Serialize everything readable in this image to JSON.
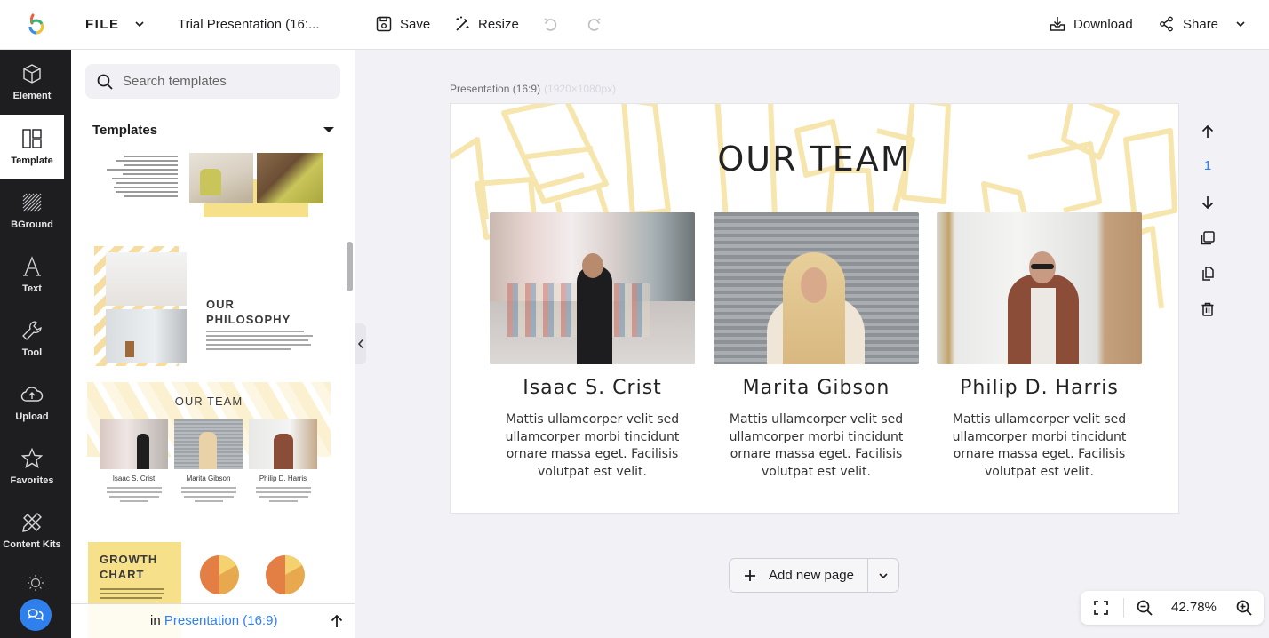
{
  "app": {
    "file_label": "FILE",
    "document_title": "Trial Presentation (16:...",
    "colors": {
      "accent": "#2f80ed",
      "rail_bg": "#1e1e20",
      "canvas_bg": "#f1f1f6",
      "theme_yellow": "#f6e08a",
      "pattern_yellow": "#fbeec2"
    }
  },
  "toolbar": {
    "save_label": "Save",
    "resize_label": "Resize",
    "undo_icon": "undo-icon",
    "redo_icon": "redo-icon",
    "download_label": "Download",
    "share_label": "Share"
  },
  "rail": {
    "items": [
      {
        "label": "Element",
        "icon": "cube-icon"
      },
      {
        "label": "Template",
        "icon": "template-icon",
        "active": true
      },
      {
        "label": "BGround",
        "icon": "background-icon"
      },
      {
        "label": "Text",
        "icon": "text-icon"
      },
      {
        "label": "Tool",
        "icon": "wrench-icon"
      },
      {
        "label": "Upload",
        "icon": "cloud-upload-icon"
      },
      {
        "label": "Favorites",
        "icon": "star-icon"
      },
      {
        "label": "Content Kits",
        "icon": "pencil-ruler-icon"
      }
    ]
  },
  "panel": {
    "search_placeholder": "Search templates",
    "heading": "Templates",
    "thumbnails": [
      {
        "name": "chair-interior"
      },
      {
        "name": "our-philosophy",
        "title_line1": "OUR",
        "title_line2": "PHILOSOPHY"
      },
      {
        "name": "our-team",
        "title": "OUR TEAM",
        "members": [
          "Isaac S. Crist",
          "Marita Gibson",
          "Philip D. Harris"
        ]
      },
      {
        "name": "growth-chart",
        "title_line1": "GROWTH",
        "title_line2": "CHART"
      }
    ],
    "footer_prefix": "in",
    "footer_link": "Presentation (16:9)"
  },
  "canvas": {
    "label": "Presentation (16:9)",
    "dimensions": "(1920×1080px)",
    "page_number": "1",
    "slide": {
      "title": "OUR TEAM",
      "members": [
        {
          "name": "Isaac S. Crist",
          "description": "Mattis ullamcorper velit sed ullamcorper morbi tincidunt ornare massa eget. Facilisis volutpat est velit."
        },
        {
          "name": "Marita Gibson",
          "description": "Mattis ullamcorper velit sed ullamcorper morbi tincidunt ornare massa eget. Facilisis volutpat est velit."
        },
        {
          "name": "Philip D. Harris",
          "description": "Mattis ullamcorper velit sed ullamcorper morbi tincidunt ornare massa eget. Facilisis volutpat est velit."
        }
      ]
    },
    "add_page_label": "Add new page",
    "zoom_level": "42.78%"
  }
}
